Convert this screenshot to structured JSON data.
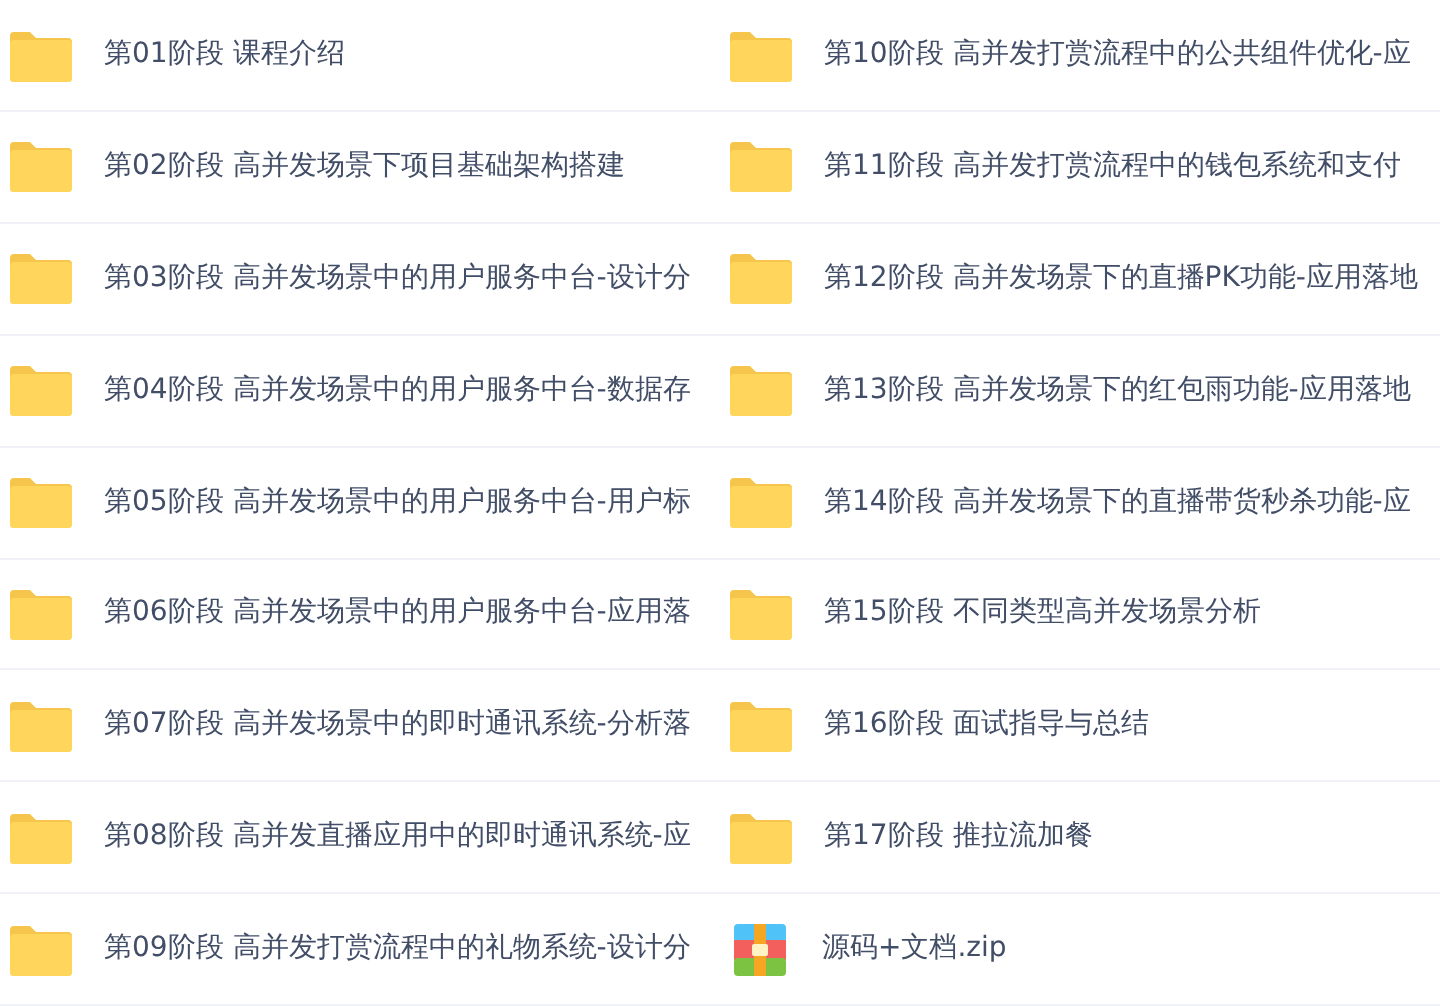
{
  "files": [
    {
      "kind": "folder",
      "name": "第01阶段 课程介绍"
    },
    {
      "kind": "folder",
      "name": "第02阶段 高并发场景下项目基础架构搭建"
    },
    {
      "kind": "folder",
      "name": "第03阶段 高并发场景中的用户服务中台-设计分"
    },
    {
      "kind": "folder",
      "name": "第04阶段 高并发场景中的用户服务中台-数据存"
    },
    {
      "kind": "folder",
      "name": "第05阶段 高并发场景中的用户服务中台-用户标"
    },
    {
      "kind": "folder",
      "name": "第06阶段 高并发场景中的用户服务中台-应用落"
    },
    {
      "kind": "folder",
      "name": "第07阶段 高并发场景中的即时通讯系统-分析落"
    },
    {
      "kind": "folder",
      "name": "第08阶段 高并发直播应用中的即时通讯系统-应"
    },
    {
      "kind": "folder",
      "name": "第09阶段 高并发打赏流程中的礼物系统-设计分"
    },
    {
      "kind": "folder",
      "name": "第10阶段 高并发打赏流程中的公共组件优化-应"
    },
    {
      "kind": "folder",
      "name": "第11阶段 高并发打赏流程中的钱包系统和支付"
    },
    {
      "kind": "folder",
      "name": "第12阶段 高并发场景下的直播PK功能-应用落地"
    },
    {
      "kind": "folder",
      "name": "第13阶段 高并发场景下的红包雨功能-应用落地"
    },
    {
      "kind": "folder",
      "name": "第14阶段 高并发场景下的直播带货秒杀功能-应"
    },
    {
      "kind": "folder",
      "name": "第15阶段 不同类型高并发场景分析"
    },
    {
      "kind": "folder",
      "name": "第16阶段 面试指导与总结"
    },
    {
      "kind": "folder",
      "name": "第17阶段 推拉流加餐"
    },
    {
      "kind": "zip",
      "name": "源码+文档.zip"
    }
  ]
}
